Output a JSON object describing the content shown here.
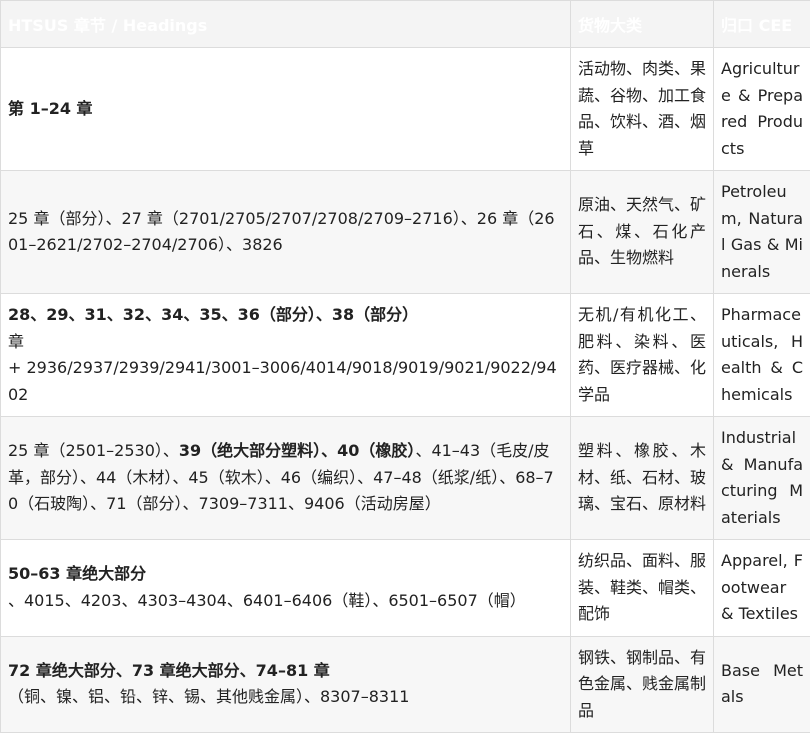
{
  "table": {
    "headers": [
      "HTSUS 章节 / Headings",
      "货物大类",
      "归口 CEE"
    ],
    "rows": [
      {
        "headings": [
          {
            "t": "第 1–24 章",
            "b": true
          }
        ],
        "category": "活动物、肉类、果蔬、谷物、加工食品、饮料、酒、烟草",
        "cee": "Agriculture & Prepared Products"
      },
      {
        "headings": [
          {
            "t": "25 章（部分）、27 章（2701/2705/2707/2708/2709–2716）、26 章（2601–2621/2702–2704/2706）、3826",
            "b": false
          }
        ],
        "category": "原油、天然气、矿石、煤、石化产品、生物燃料",
        "cee": "Petroleum, Natural Gas & Minerals"
      },
      {
        "headings": [
          {
            "t": "28、29、31、32、34、35、36（部分）、38（部分）",
            "b": true
          },
          {
            "t": "章",
            "b": false,
            "br": true
          },
          {
            "t": "+ 2936/2937/2939/2941/3001–3006/4014/9018/9019/9021/9022/9402",
            "b": false,
            "br": true
          }
        ],
        "category": "无机/有机化工、肥料、染料、医药、医疗器械、化学品",
        "cee": "Pharmaceuticals, Health & Chemicals"
      },
      {
        "headings": [
          {
            "t": "25 章（2501–2530）、",
            "b": false
          },
          {
            "t": "39（绝大部分塑料）、40（橡胶）",
            "b": true
          },
          {
            "t": "、41–43（毛皮/皮革，部分）、44（木材）、45（软木）、46（编织）、47–48（纸浆/纸）、68–70（石玻陶）、71（部分）、7309–7311、9406（活动房屋）",
            "b": false
          }
        ],
        "category": "塑料、橡胶、木材、纸、石材、玻璃、宝石、原材料",
        "cee": "Industrial & Manufacturing Materials"
      },
      {
        "headings": [
          {
            "t": "50–63 章绝大部分",
            "b": true
          },
          {
            "t": "、4015、4203、4303–4304、6401–6406（鞋）、6501–6507（帽）",
            "b": false,
            "br": true
          }
        ],
        "category": "纺织品、面料、服装、鞋类、帽类、配饰",
        "cee": "Apparel, Footwear & Textiles"
      },
      {
        "headings": [
          {
            "t": "72 章绝大部分、73 章绝大部分、74–81 章",
            "b": true
          },
          {
            "t": "（铜、镍、铝、铅、锌、锡、其他贱金属）、8307–8311",
            "b": false,
            "br": true
          }
        ],
        "category": "钢铁、钢制品、有色金属、贱金属制品",
        "cee": "Base Metals"
      }
    ]
  }
}
